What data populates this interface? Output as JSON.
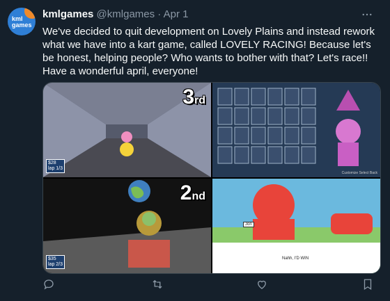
{
  "tweet": {
    "avatar_text": "kml games",
    "display_name": "kmlgames",
    "handle": "@kmlgames",
    "separator": "·",
    "date": "Apr 1",
    "more_icon": "more-icon",
    "text": "We've decided to quit development on Lovely Plains and instead rework what we have into a kart game, called LOVELY RACING! Because let's be honest, helping people? Who wants to bother with that? Let's race!! Have a wonderful april, everyone!"
  },
  "media": {
    "panels": [
      {
        "rank_num": "3",
        "rank_suffix": "rd",
        "stat_line1": "$28",
        "stat_line2": "lap 1/3"
      },
      {
        "menu": "Customize   Select   Back"
      },
      {
        "rank_num": "2",
        "rank_suffix": "nd",
        "stat_line1": "$35",
        "stat_line2": "lap 2/3"
      },
      {
        "char_name": "Jon",
        "hint": "Nahh, I'D WIN"
      }
    ]
  },
  "actions": {
    "reply_icon": "reply-icon",
    "retweet_icon": "retweet-icon",
    "like_icon": "heart-icon",
    "bookmark_icon": "bookmark-icon"
  },
  "colors": {
    "background": "#15202b",
    "text": "#f7f9f9",
    "secondary": "#8b98a5",
    "border": "#38444d"
  }
}
